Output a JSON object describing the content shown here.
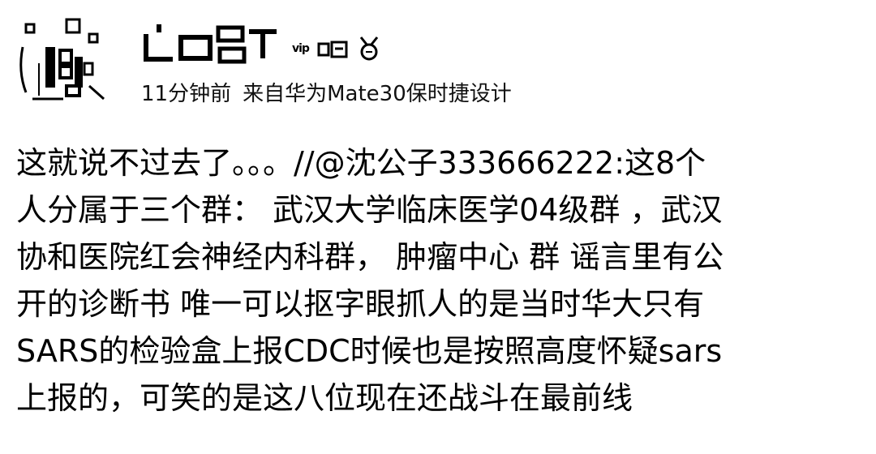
{
  "post": {
    "timestamp": "11分钟前",
    "source": "来自华为Mate30保时捷设计",
    "vip_badge": "vip",
    "body_lines": [
      "这就说不过去了。。。//@沈公子333666222:这8个",
      "人分属于三个群： 武汉大学临床医学04级群 ，武汉",
      "协和医院红会神经内科群， 肿瘤中心 群 谣言里有公",
      "开的诊断书 唯一可以抠字眼抓人的是当时华大只有",
      "SARS的检验盒上报CDC时候也是按照高度怀疑sars",
      "上报的，可笑的是这八位现在还战斗在最前线"
    ]
  },
  "icons": {
    "avatar": "avatar-icon",
    "username": "redacted-username-icon",
    "vip": "vip-badge-icon",
    "medal": "medal-icon"
  }
}
